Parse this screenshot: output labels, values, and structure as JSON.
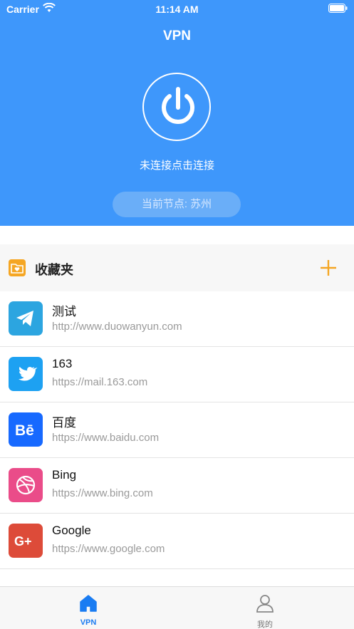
{
  "status_bar": {
    "carrier": "Carrier",
    "time": "11:14 AM"
  },
  "header": {
    "title": "VPN",
    "connect_hint": "未连接点击连接",
    "current_node": "当前节点: 苏州"
  },
  "favorites": {
    "title": "收藏夹",
    "items": [
      {
        "name": "测试",
        "url": "http://www.duowanyun.com",
        "icon": "telegram-icon",
        "color": "#2ca5e0"
      },
      {
        "name": "163",
        "url": "https://mail.163.com",
        "icon": "twitter-icon",
        "color": "#1da1f2"
      },
      {
        "name": "百度",
        "url": "https://www.baidu.com",
        "icon": "behance-icon",
        "color": "#1769ff"
      },
      {
        "name": "Bing",
        "url": "https://www.bing.com",
        "icon": "dribbble-icon",
        "color": "#ea4c89"
      },
      {
        "name": "Google",
        "url": "https://www.google.com",
        "icon": "google-plus-icon",
        "color": "#dd4b39"
      }
    ]
  },
  "tab_bar": {
    "tabs": [
      {
        "label": "VPN",
        "icon": "home-icon",
        "active": true
      },
      {
        "label": "我的",
        "icon": "user-icon",
        "active": false
      }
    ]
  },
  "colors": {
    "primary": "#3e97fb",
    "accent": "#f5a623",
    "tab_active": "#1a7cf2"
  }
}
